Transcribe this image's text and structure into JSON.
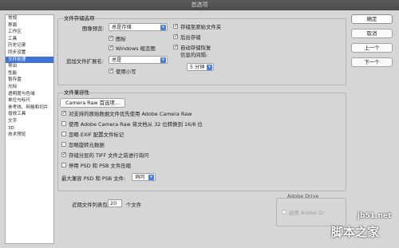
{
  "window": {
    "title": "首选项"
  },
  "sidebar": {
    "items": [
      {
        "label": "常规"
      },
      {
        "label": "界面"
      },
      {
        "label": "工作区"
      },
      {
        "label": "工具"
      },
      {
        "label": "历史记录"
      },
      {
        "label": "同步设置"
      },
      {
        "label": "文件处理",
        "active": true
      },
      {
        "label": "导出"
      },
      {
        "label": "性能"
      },
      {
        "label": "暂存盘"
      },
      {
        "label": "光标"
      },
      {
        "label": "透明度与色域"
      },
      {
        "label": "单位与标尺"
      },
      {
        "label": "参考线、网格和切片"
      },
      {
        "label": "增效工具"
      },
      {
        "label": "文字"
      },
      {
        "label": "3D"
      },
      {
        "label": "技术预览"
      }
    ]
  },
  "file_save": {
    "title": "文件存储选项",
    "image_preview_label": "图像预览:",
    "image_preview_value": "总是存储",
    "icon_label": "图标",
    "windows_thumb_label": "Windows 缩览图",
    "ext_label": "追加文件扩展名:",
    "ext_value": "总是",
    "lowercase_label": "使用小写",
    "save_to_original_label": "存储至原始文件夹",
    "background_save_label": "后台存储",
    "autosave_label_1": "自动存储恢复",
    "autosave_label_2": "信息的间隔:",
    "autosave_interval": "5 分钟"
  },
  "compat": {
    "title": "文件兼容性",
    "camera_raw_button": "Camera Raw 首选项...",
    "opt1": "对支持的原始数据文件优先使用 Adobe Camera Raw",
    "opt2": "使用 Adobe Camera Raw 将文档从 32 位转换到 16/8 位",
    "opt3": "忽略 EXIF 配置文件标记",
    "opt4": "忽略旋转元数据",
    "opt5": "存储分层的 TIFF 文件之前进行询问",
    "opt6": "停用 PSD 和 PSB 文件压缩",
    "max_compat_label": "最大兼容 PSD 和 PSB 文件:",
    "max_compat_value": "询问"
  },
  "recent": {
    "label": "近期文件列表包含:",
    "value": "20",
    "unit": "个文件"
  },
  "adobe_drive": {
    "title": "Adobe Drive",
    "enable_label": "启用 Adobe Dr"
  },
  "buttons": {
    "ok": "确定",
    "cancel": "取消",
    "prev": "上一个",
    "next": "下一个"
  },
  "watermark": {
    "line1": "jb51.net",
    "line2": "脚本之家"
  }
}
